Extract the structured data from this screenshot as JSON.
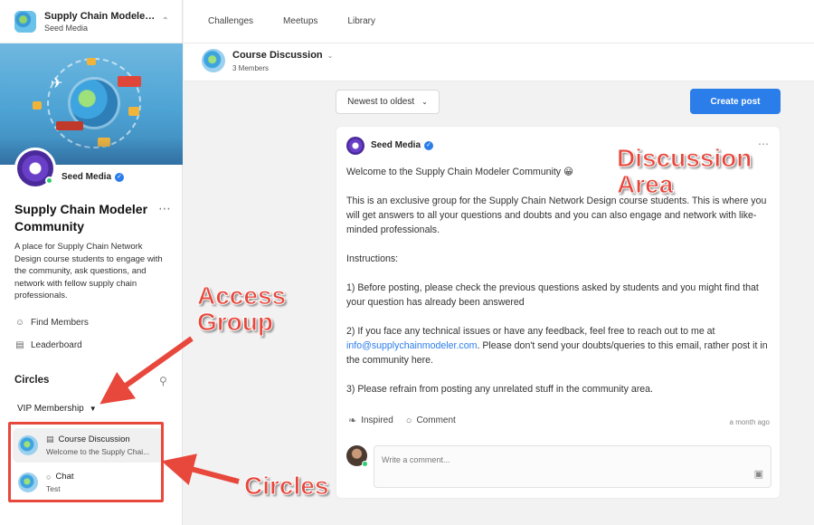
{
  "sidebar": {
    "app_title": "Supply Chain Modeler Co...",
    "app_subtitle": "Seed Media",
    "profile_name": "Seed Media",
    "community_title": "Supply Chain Modeler Community",
    "community_description": "A place for Supply Chain Network Design course students to engage with the community, ask questions, and network with fellow supply chain professionals.",
    "nav": [
      {
        "label": "Find Members",
        "icon": "person-icon"
      },
      {
        "label": "Leaderboard",
        "icon": "bar-chart-icon"
      }
    ],
    "circles_label": "Circles",
    "group_label": "VIP Membership",
    "circles": [
      {
        "name": "Course Discussion",
        "subtitle": "Welcome to the Supply Chai...",
        "icon": "document-icon"
      },
      {
        "name": "Chat",
        "subtitle": "Test",
        "icon": "chat-bubble-icon"
      }
    ]
  },
  "topbar": {
    "tabs": [
      "Challenges",
      "Meetups",
      "Library"
    ]
  },
  "channel": {
    "name": "Course Discussion",
    "members": "3 Members"
  },
  "toolbar": {
    "sort_label": "Newest to oldest",
    "create_label": "Create post"
  },
  "post": {
    "author": "Seed Media",
    "paragraphs": [
      "Welcome to the Supply Chain Modeler Community 😀",
      "This is an exclusive group for the Supply Chain Network Design course students. This is where you will get answers to all your questions and doubts and you can also engage and network with like-minded professionals.",
      "Instructions:",
      "1) Before posting, please check the previous questions asked by students and you might find that your question has already been answered",
      "2) If you face any technical issues or have any feedback, feel free to reach out to me at",
      "info@supplychainmodeler.com",
      ". Please don't send your doubts/queries to this email, rather post it in the community here.",
      "3) Please refrain from posting any unrelated stuff in the community area."
    ],
    "inspired_label": "Inspired",
    "comment_label": "Comment",
    "time": "a month ago",
    "comment_placeholder": "Write a comment..."
  },
  "annotations": {
    "discussion_line1": "Discussion",
    "discussion_line2": "Area",
    "access_line1": "Access",
    "access_line2": "Group",
    "circles": "Circles",
    "color": "#e8473c"
  },
  "colors": {
    "accent": "#2b7de9",
    "online": "#2ecc71"
  }
}
